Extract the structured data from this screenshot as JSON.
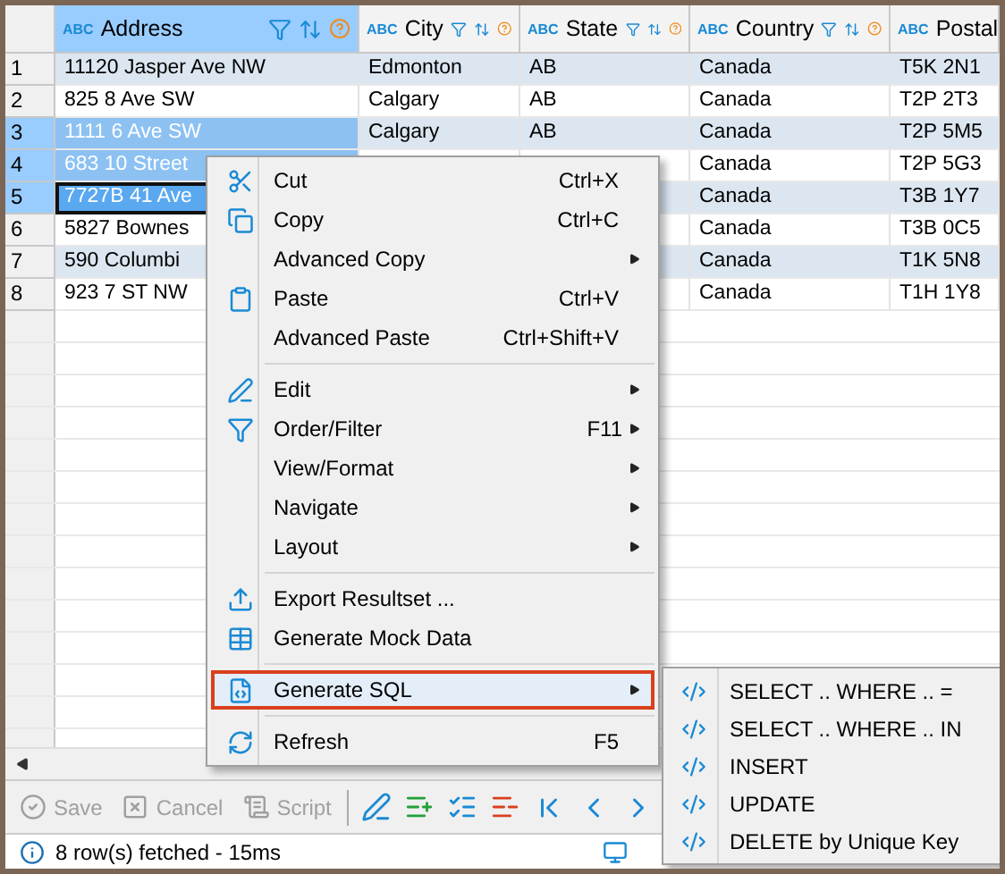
{
  "grid": {
    "columns": [
      {
        "type_label": "ABC",
        "name": "Address",
        "selected": true
      },
      {
        "type_label": "ABC",
        "name": "City",
        "selected": false
      },
      {
        "type_label": "ABC",
        "name": "State",
        "selected": false
      },
      {
        "type_label": "ABC",
        "name": "Country",
        "selected": false
      },
      {
        "type_label": "ABC",
        "name": "Postal",
        "selected": false
      }
    ],
    "rows": [
      {
        "number": "1",
        "selected": false,
        "focused": false,
        "cells": [
          "11120 Jasper Ave NW",
          "Edmonton",
          "AB",
          "Canada",
          "T5K 2N1"
        ]
      },
      {
        "number": "2",
        "selected": false,
        "focused": false,
        "cells": [
          "825 8 Ave SW",
          "Calgary",
          "AB",
          "Canada",
          "T2P 2T3"
        ]
      },
      {
        "number": "3",
        "selected": true,
        "focused": false,
        "cells": [
          "1111 6 Ave SW",
          "Calgary",
          "AB",
          "Canada",
          "T2P 5M5"
        ]
      },
      {
        "number": "4",
        "selected": true,
        "focused": false,
        "cells": [
          "683 10 Street",
          null,
          null,
          "Canada",
          "T2P 5G3"
        ]
      },
      {
        "number": "5",
        "selected": true,
        "focused": true,
        "cells": [
          "7727B 41 Ave",
          null,
          null,
          "Canada",
          "T3B 1Y7"
        ]
      },
      {
        "number": "6",
        "selected": false,
        "focused": false,
        "cells": [
          "5827 Bownes",
          null,
          null,
          "Canada",
          "T3B 0C5"
        ]
      },
      {
        "number": "7",
        "selected": false,
        "focused": false,
        "cells": [
          "590 Columbi",
          null,
          null,
          "Canada",
          "T1K 5N8"
        ]
      },
      {
        "number": "8",
        "selected": false,
        "focused": false,
        "cells": [
          "923 7 ST NW",
          null,
          null,
          "Canada",
          "T1H 1Y8"
        ]
      }
    ]
  },
  "context_menu": {
    "items": [
      {
        "kind": "item",
        "label": "Cut",
        "shortcut": "Ctrl+X",
        "submenu": false,
        "highlighted": false
      },
      {
        "kind": "item",
        "label": "Copy",
        "shortcut": "Ctrl+C",
        "submenu": false,
        "highlighted": false
      },
      {
        "kind": "item",
        "label": "Advanced Copy",
        "submenu": true,
        "highlighted": false
      },
      {
        "kind": "item",
        "label": "Paste",
        "shortcut": "Ctrl+V",
        "submenu": false,
        "highlighted": false
      },
      {
        "kind": "item",
        "label": "Advanced Paste",
        "shortcut": "Ctrl+Shift+V",
        "submenu": false,
        "highlighted": false
      },
      {
        "kind": "separator"
      },
      {
        "kind": "item",
        "label": "Edit",
        "submenu": true,
        "highlighted": false
      },
      {
        "kind": "item",
        "label": "Order/Filter",
        "shortcut": "F11",
        "submenu": true,
        "highlighted": false
      },
      {
        "kind": "item",
        "label": "View/Format",
        "submenu": true,
        "highlighted": false
      },
      {
        "kind": "item",
        "label": "Navigate",
        "submenu": true,
        "highlighted": false
      },
      {
        "kind": "item",
        "label": "Layout",
        "submenu": true,
        "highlighted": false
      },
      {
        "kind": "separator"
      },
      {
        "kind": "item",
        "label": "Export Resultset ...",
        "submenu": false,
        "highlighted": false
      },
      {
        "kind": "item",
        "label": "Generate Mock Data",
        "submenu": false,
        "highlighted": false
      },
      {
        "kind": "separator"
      },
      {
        "kind": "item",
        "label": "Generate SQL",
        "submenu": true,
        "highlighted": true
      },
      {
        "kind": "separator"
      },
      {
        "kind": "item",
        "label": "Refresh",
        "shortcut": "F5",
        "submenu": false,
        "highlighted": false
      }
    ]
  },
  "submenu": {
    "items": [
      "SELECT .. WHERE .. =",
      "SELECT .. WHERE .. IN",
      "INSERT",
      "UPDATE",
      "DELETE by Unique Key"
    ]
  },
  "toolbar": {
    "buttons": [
      {
        "kind": "save",
        "label": "Save",
        "disabled": true
      },
      {
        "kind": "cancel",
        "label": "Cancel",
        "disabled": true
      },
      {
        "kind": "script",
        "label": "Script",
        "disabled": true
      }
    ]
  },
  "status_bar": {
    "text": "8 row(s) fetched - 15ms"
  }
}
